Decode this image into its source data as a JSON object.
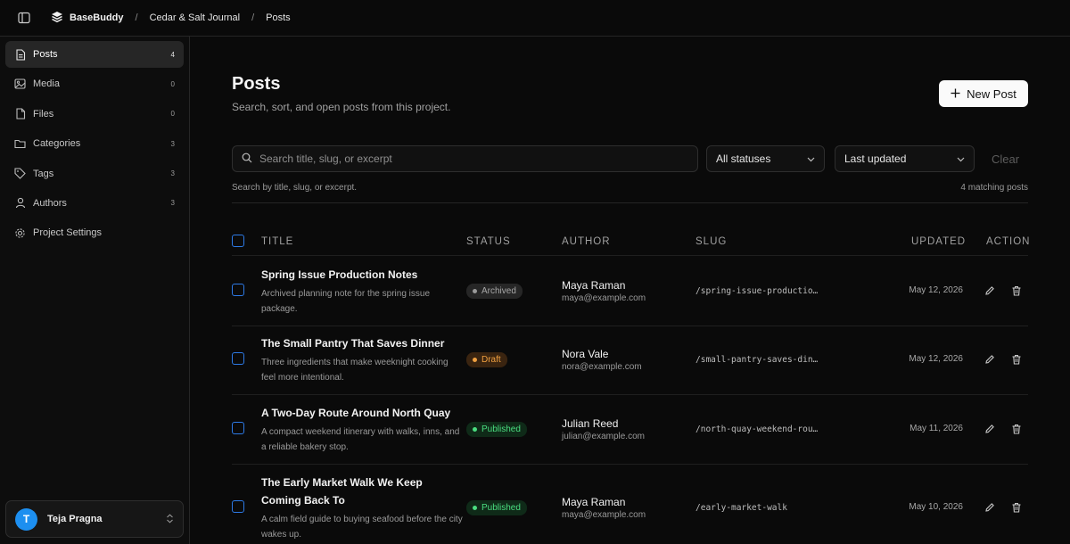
{
  "topbar": {
    "brand": "BaseBuddy",
    "breadcrumb": [
      "Cedar & Salt Journal",
      "Posts"
    ]
  },
  "sidebar": {
    "items": [
      {
        "label": "Posts",
        "count": "4",
        "icon": "document-icon",
        "active": true
      },
      {
        "label": "Media",
        "count": "0",
        "icon": "image-icon"
      },
      {
        "label": "Files",
        "count": "0",
        "icon": "file-icon"
      },
      {
        "label": "Categories",
        "count": "3",
        "icon": "folder-icon"
      },
      {
        "label": "Tags",
        "count": "3",
        "icon": "tag-icon"
      },
      {
        "label": "Authors",
        "count": "3",
        "icon": "user-icon"
      },
      {
        "label": "Project Settings",
        "count": "",
        "icon": "gear-icon"
      }
    ],
    "user": {
      "initial": "T",
      "name": "Teja Pragna"
    }
  },
  "main": {
    "title": "Posts",
    "subtitle": "Search, sort, and open posts from this project.",
    "new_post_label": "New Post",
    "search_placeholder": "Search title, slug, or excerpt",
    "status_filter": "All statuses",
    "sort_filter": "Last updated",
    "clear_label": "Clear",
    "hint": "Search by title, slug, or excerpt.",
    "matching": "4 matching posts"
  },
  "table": {
    "headers": {
      "title": "TITLE",
      "status": "STATUS",
      "author": "AUTHOR",
      "slug": "SLUG",
      "updated": "UPDATED",
      "action": "ACTION"
    },
    "rows": [
      {
        "title": "Spring Issue Production Notes",
        "excerpt": "Archived planning note for the spring issue package.",
        "status": "Archived",
        "author": "Maya Raman",
        "email": "maya@example.com",
        "slug": "/spring-issue-productio…",
        "updated": "May 12, 2026"
      },
      {
        "title": "The Small Pantry That Saves Dinner",
        "excerpt": "Three ingredients that make weeknight cooking feel more intentional.",
        "status": "Draft",
        "author": "Nora Vale",
        "email": "nora@example.com",
        "slug": "/small-pantry-saves-din…",
        "updated": "May 12, 2026"
      },
      {
        "title": "A Two-Day Route Around North Quay",
        "excerpt": "A compact weekend itinerary with walks, inns, and a reliable bakery stop.",
        "status": "Published",
        "author": "Julian Reed",
        "email": "julian@example.com",
        "slug": "/north-quay-weekend-rou…",
        "updated": "May 11, 2026"
      },
      {
        "title": "The Early Market Walk We Keep Coming Back To",
        "excerpt": "A calm field guide to buying seafood before the city wakes up.",
        "status": "Published",
        "author": "Maya Raman",
        "email": "maya@example.com",
        "slug": "/early-market-walk",
        "updated": "May 10, 2026"
      }
    ]
  },
  "colors": {
    "accent": "#2d7ae6",
    "archived": "#9a9a9a",
    "draft": "#f0a040",
    "published": "#4ade80"
  }
}
